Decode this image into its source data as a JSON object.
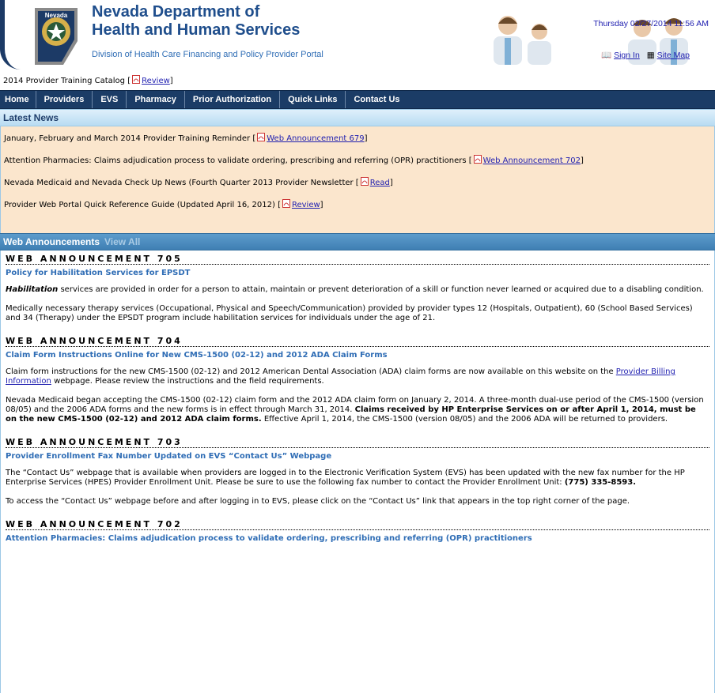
{
  "header": {
    "title_line1": "Nevada Department of",
    "title_line2": "Health and Human Services",
    "subtitle": "Division of Health Care Financing and Policy Provider Portal",
    "logo_text": "Nevada",
    "datetime": "Thursday 02/27/2014 11:56 AM",
    "link_partial": "Sign In",
    "link_sitemap": "Site Map"
  },
  "catalog": {
    "text": "2014 Provider Training Catalog [",
    "link": "Review",
    "close": "]"
  },
  "nav": {
    "tabs": [
      "Home",
      "Providers",
      "EVS",
      "Pharmacy",
      "Prior Authorization",
      "Quick Links",
      "Contact Us"
    ]
  },
  "latest_news": {
    "heading": "Latest News",
    "items": [
      {
        "text": "January, February and March 2014 Provider Training Reminder [",
        "link": "Web Announcement 679",
        "close": "]"
      },
      {
        "text": "Attention Pharmacies: Claims adjudication process to validate ordering, prescribing and referring (OPR) practitioners [",
        "link": "Web Announcement 702",
        "close": "]"
      },
      {
        "text": "Nevada Medicaid and Nevada Check Up News (Fourth Quarter 2013 Provider Newsletter [",
        "link": "Read",
        "close": "]"
      },
      {
        "text": "Provider Web Portal Quick Reference Guide (Updated April 16, 2012) [",
        "link": "Review",
        "close": "]"
      }
    ]
  },
  "announcements": {
    "heading": "Web Announcements",
    "view_all": "View All",
    "a705": {
      "label": "WEB ANNOUNCEMENT 705",
      "title": "Policy for Habilitation Services for EPSDT",
      "p1_bold": "Habilitation",
      "p1_rest": " services are provided in order for a person to attain, maintain or prevent deterioration of a skill or function never learned or acquired due to a disabling condition.",
      "p2": "Medically necessary therapy services (Occupational, Physical and Speech/Communication) provided by provider types 12 (Hospitals, Outpatient), 60 (School Based Services) and 34 (Therapy) under the EPSDT program include habilitation services for individuals under the age of 21."
    },
    "a704": {
      "label": "WEB ANNOUNCEMENT 704",
      "title": "Claim Form Instructions Online for New CMS-1500 (02-12) and 2012 ADA Claim Forms",
      "p1_a": "Claim form instructions for the new CMS-1500 (02-12) and 2012 American Dental Association (ADA) claim forms are now available on this website on the ",
      "p1_link": "Provider Billing Information",
      "p1_b": " webpage. Please review the instructions and the field requirements.",
      "p2_a": "Nevada Medicaid began accepting the CMS-1500 (02-12) claim form and the 2012 ADA claim form on January 2, 2014. A three-month dual-use period of the CMS-1500 (version 08/05) and the 2006 ADA forms and the new forms is in effect through March 31, 2014. ",
      "p2_bold": "Claims received by HP Enterprise Services on or after April 1, 2014, must be on the new CMS-1500 (02-12) and 2012 ADA claim forms.",
      "p2_b": " Effective April 1, 2014, the CMS-1500 (version 08/05) and the 2006 ADA will be returned to providers."
    },
    "a703": {
      "label": "WEB ANNOUNCEMENT 703",
      "title": "Provider Enrollment Fax Number Updated on EVS “Contact Us” Webpage",
      "p1_a": "The “Contact Us” webpage that is available when providers are logged in to the Electronic Verification System (EVS) has been updated with the new fax number for the HP Enterprise Services (HPES) Provider Enrollment Unit. Please be sure to use the following fax number to contact the Provider Enrollment Unit: ",
      "p1_bold": "(775) 335-8593.",
      "p2": "To access the “Contact Us” webpage before and after logging in to EVS, please click on the “Contact Us” link that appears in the top right corner of the page."
    },
    "a702": {
      "label": "WEB ANNOUNCEMENT 702",
      "title": "Attention Pharmacies: Claims adjudication process to validate ordering, prescribing and referring (OPR) practitioners"
    }
  },
  "colors": {
    "nav_bg": "#1b3c66",
    "news_bg": "#fbe6cd",
    "title_blue": "#1f4e8c",
    "link": "#1f1fb0"
  }
}
